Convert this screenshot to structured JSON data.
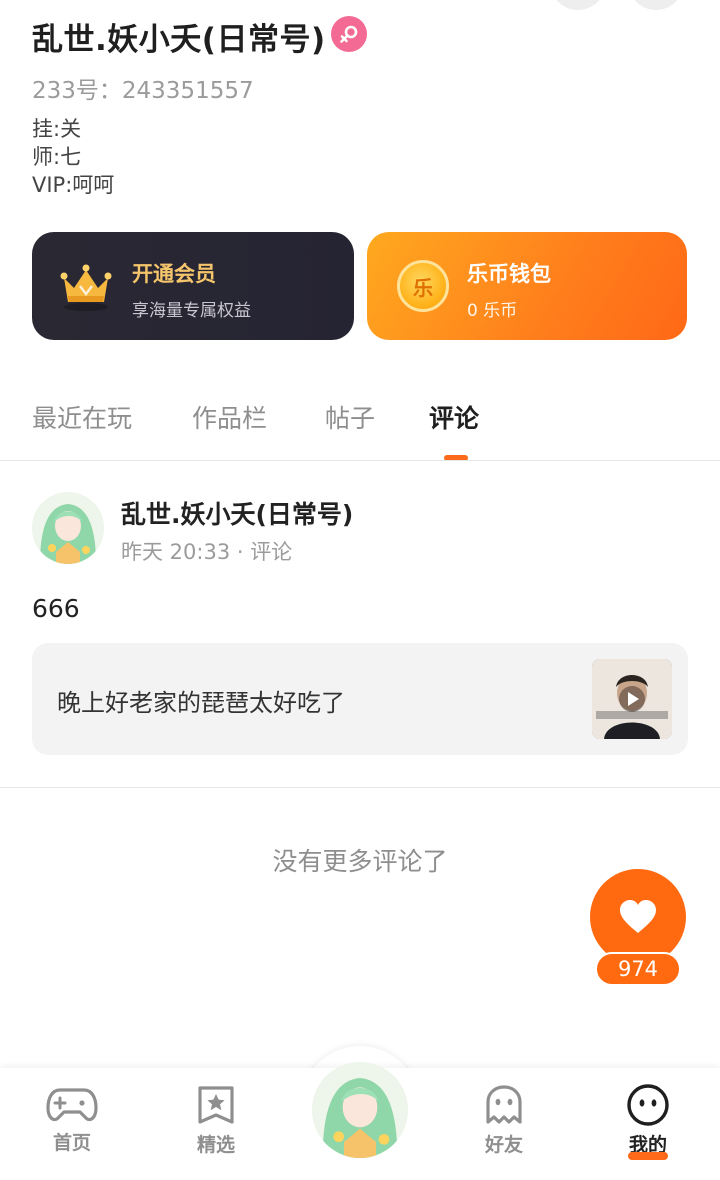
{
  "profile": {
    "name": "乱世.妖小夭(日常号)",
    "uid": "233号：243351557",
    "bio_lines": [
      "挂:关",
      "师:七",
      "VIP:呵呵"
    ],
    "gender_icon": "female-icon"
  },
  "cards": {
    "vip": {
      "title": "开通会员",
      "subtitle": "享海量专属权益",
      "icon": "crown-icon"
    },
    "coin": {
      "title": "乐币钱包",
      "subtitle": "0 乐币",
      "icon_text": "乐"
    }
  },
  "tabs": [
    {
      "label": "最近在玩",
      "active": false
    },
    {
      "label": "作品栏",
      "active": false
    },
    {
      "label": "帖子",
      "active": false
    },
    {
      "label": "评论",
      "active": true
    }
  ],
  "comment": {
    "author": "乱世.妖小夭(日常号)",
    "meta": "昨天 20:33 · 评论",
    "text": "666",
    "quote": {
      "text": "晚上好老家的琵琶太好吃了",
      "thumb_icon": "video-thumbnail-icon"
    }
  },
  "empty_text": "没有更多评论了",
  "like": {
    "count": "974",
    "icon": "heart-icon"
  },
  "nav": [
    {
      "label": "首页",
      "icon": "gamepad-icon",
      "active": false
    },
    {
      "label": "精选",
      "icon": "star-bookmark-icon",
      "active": false
    },
    {
      "label": "",
      "icon": "avatar-center",
      "active": false
    },
    {
      "label": "好友",
      "icon": "ghost-icon",
      "active": false
    },
    {
      "label": "我的",
      "icon": "smiley-icon",
      "active": true
    }
  ],
  "colors": {
    "accent": "#ff6a10",
    "vip_gold": "#f5c56b",
    "female_pink": "#f36b95"
  }
}
